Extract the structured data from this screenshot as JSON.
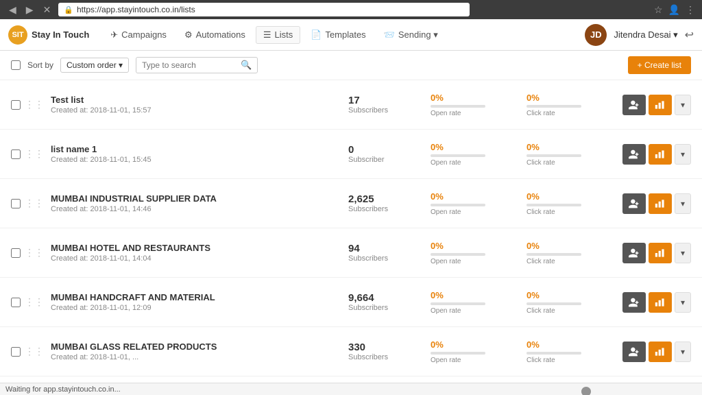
{
  "browser": {
    "url": "https://app.stayintouch.co.in/lists",
    "back_label": "◀",
    "forward_label": "▶",
    "refresh_label": "✕",
    "star_label": "☆",
    "account_label": "👤",
    "menu_label": "⋮"
  },
  "nav": {
    "brand_name": "Stay In Touch",
    "items": [
      {
        "id": "campaigns",
        "label": "Campaigns",
        "icon": "✈"
      },
      {
        "id": "automations",
        "label": "Automations",
        "icon": "⚙"
      },
      {
        "id": "lists",
        "label": "Lists",
        "icon": "☰",
        "active": true
      },
      {
        "id": "templates",
        "label": "Templates",
        "icon": "📄"
      },
      {
        "id": "sending",
        "label": "Sending ▾",
        "icon": "📨"
      }
    ],
    "user_name": "Jitendra Desai ▾",
    "user_initials": "JD"
  },
  "toolbar": {
    "sort_label": "Sort by",
    "sort_value": "Custom order ▾",
    "search_placeholder": "Type to search",
    "create_list_label": "+ Create list"
  },
  "lists": [
    {
      "name": "Test list",
      "created": "Created at: 2018-11-01, 15:57",
      "subscribers": "17",
      "sub_label": "Subscribers",
      "open_rate_pct": "0%",
      "open_rate_label": "Open rate",
      "open_bar_width": "0",
      "click_rate_pct": "0%",
      "click_rate_label": "Click rate",
      "click_bar_width": "0"
    },
    {
      "name": "list name 1",
      "created": "Created at: 2018-11-01, 15:45",
      "subscribers": "0",
      "sub_label": "Subscriber",
      "open_rate_pct": "0%",
      "open_rate_label": "Open rate",
      "open_bar_width": "0",
      "click_rate_pct": "0%",
      "click_rate_label": "Click rate",
      "click_bar_width": "0"
    },
    {
      "name": "MUMBAI INDUSTRIAL SUPPLIER DATA",
      "created": "Created at: 2018-11-01, 14:46",
      "subscribers": "2,625",
      "sub_label": "Subscribers",
      "open_rate_pct": "0%",
      "open_rate_label": "Open rate",
      "open_bar_width": "0",
      "click_rate_pct": "0%",
      "click_rate_label": "Click rate",
      "click_bar_width": "0"
    },
    {
      "name": "MUMBAI HOTEL AND RESTAURANTS",
      "created": "Created at: 2018-11-01, 14:04",
      "subscribers": "94",
      "sub_label": "Subscribers",
      "open_rate_pct": "0%",
      "open_rate_label": "Open rate",
      "open_bar_width": "0",
      "click_rate_pct": "0%",
      "click_rate_label": "Click rate",
      "click_bar_width": "0"
    },
    {
      "name": "MUMBAI HANDCRAFT AND MATERIAL",
      "created": "Created at: 2018-11-01, 12:09",
      "subscribers": "9,664",
      "sub_label": "Subscribers",
      "open_rate_pct": "0%",
      "open_rate_label": "Open rate",
      "open_bar_width": "0",
      "click_rate_pct": "0%",
      "click_rate_label": "Click rate",
      "click_bar_width": "0"
    },
    {
      "name": "MUMBAI GLASS RELATED PRODUCTS",
      "created": "Created at: 2018-11-01, ...",
      "subscribers": "330",
      "sub_label": "Subscribers",
      "open_rate_pct": "0%",
      "open_rate_label": "Open rate",
      "open_bar_width": "0",
      "click_rate_pct": "0%",
      "click_rate_label": "Click rate",
      "click_bar_width": "0"
    }
  ],
  "status_bar": {
    "text": "Waiting for app.stayintouch.co.in..."
  },
  "actions": {
    "add_icon": "👤+",
    "chart_icon": "📊",
    "more_icon": "▾"
  }
}
